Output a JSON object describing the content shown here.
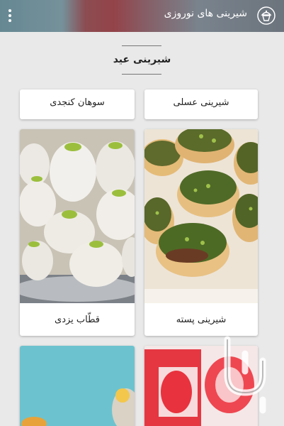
{
  "app": {
    "title": "شیرینی های نوروزی"
  },
  "section": {
    "title": "شیرینی عید"
  },
  "cards": [
    {
      "label": "شیرینی عسلی"
    },
    {
      "label": "سوهان کنجدی"
    },
    {
      "label": "شیرینی پسته"
    },
    {
      "label": "قطّاب  یزدی"
    }
  ],
  "icons": {
    "menu": "overflow-menu-icon",
    "logo": "cupcake-logo-icon",
    "watermark": "store-watermark-icon"
  }
}
